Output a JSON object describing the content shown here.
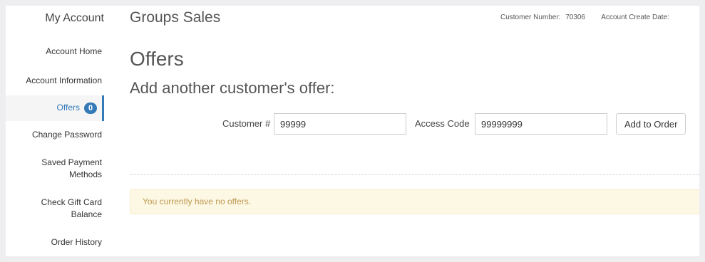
{
  "sidebar": {
    "title": "My Account",
    "items": [
      {
        "label": "Account Home"
      },
      {
        "label": "Account Information"
      },
      {
        "label": "Offers",
        "badge": "0",
        "active": true
      },
      {
        "label": "Change Password"
      },
      {
        "label": "Saved Payment Methods",
        "lines": [
          "Saved Payment",
          "Methods"
        ]
      },
      {
        "label": "Check Gift Card Balance",
        "lines": [
          "Check Gift Card",
          "Balance"
        ]
      },
      {
        "label": "Order History"
      }
    ]
  },
  "header": {
    "site_title": "Groups Sales",
    "customer_number_label": "Customer Number:",
    "customer_number_value": "70306",
    "account_create_label": "Account Create Date:"
  },
  "main": {
    "page_title": "Offers",
    "section_title": "Add another customer's offer:",
    "form": {
      "customer_label": "Customer #",
      "customer_value": "99999",
      "access_label": "Access Code",
      "access_value": "99999999",
      "submit_label": "Add to Order"
    },
    "empty_message": "You currently have no offers."
  },
  "colors": {
    "accent": "#337ab7",
    "alert_bg": "#fcf8e3",
    "alert_text": "#c09853"
  }
}
